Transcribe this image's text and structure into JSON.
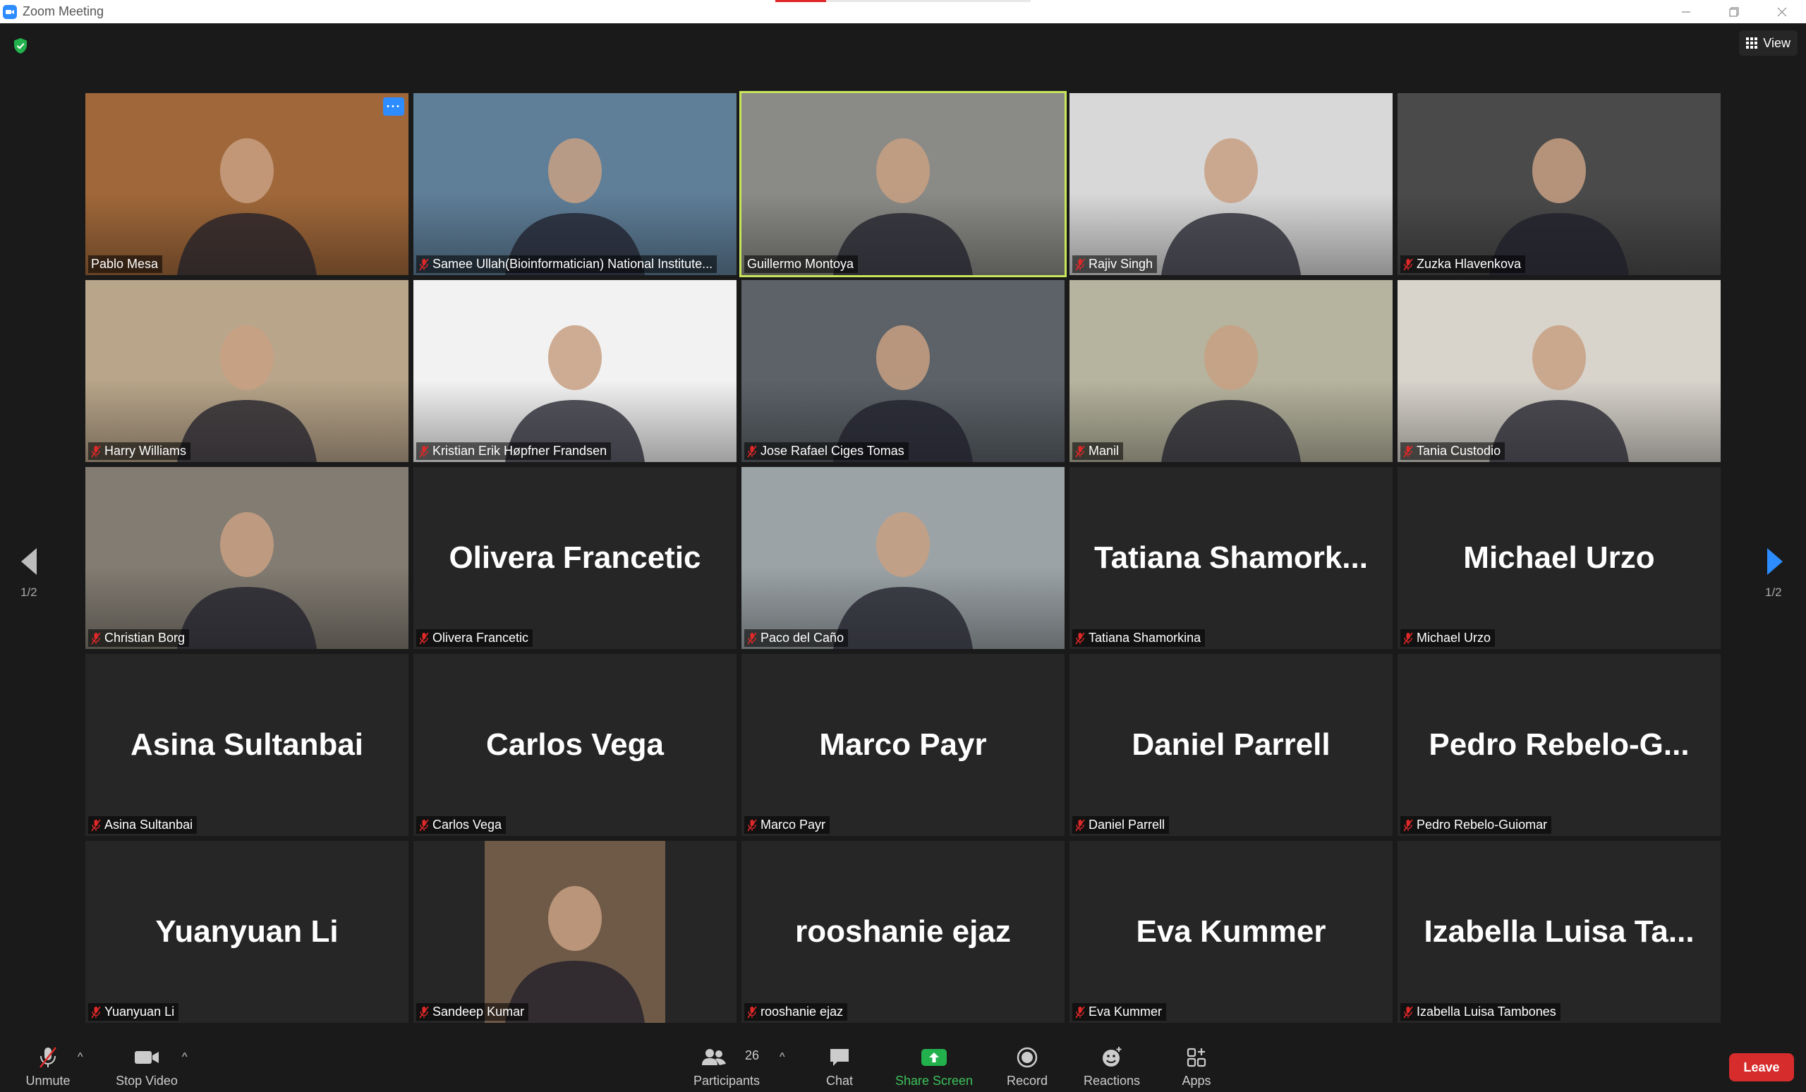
{
  "window": {
    "title": "Zoom Meeting"
  },
  "view": {
    "label": "View"
  },
  "pagination": {
    "left": "1/2",
    "right": "1/2"
  },
  "participants": [
    {
      "name": "Pablo Mesa",
      "video": true,
      "muted": false,
      "more": true,
      "bg": "#a0683a"
    },
    {
      "name": "Samee Ullah(Bioinformatician) National Institute...",
      "video": true,
      "muted": true,
      "bg": "#5f7e98"
    },
    {
      "name": "Guillermo Montoya",
      "video": true,
      "muted": false,
      "speaking": true,
      "bg": "#8a8a86"
    },
    {
      "name": "Rajiv Singh",
      "video": true,
      "muted": true,
      "bg": "#d8d8d8"
    },
    {
      "name": "Zuzka Hlavenkova",
      "video": true,
      "muted": true,
      "bg": "#4a4a4a"
    },
    {
      "name": "Harry Williams",
      "video": true,
      "muted": true,
      "bg": "#b8a58a"
    },
    {
      "name": "Kristian Erik Høpfner Frandsen",
      "video": true,
      "muted": true,
      "bg": "#f2f2f2"
    },
    {
      "name": "Jose Rafael Ciges Tomas",
      "video": true,
      "muted": true,
      "bg": "#5c6268"
    },
    {
      "name": "Manil",
      "video": true,
      "muted": true,
      "bg": "#b6b49e"
    },
    {
      "name": "Tania Custodio",
      "video": true,
      "muted": true,
      "bg": "#d8d4cc"
    },
    {
      "name": "Christian Borg",
      "video": true,
      "muted": true,
      "bg": "#827c72"
    },
    {
      "name": "Olivera Francetic",
      "display": "Olivera Francetic",
      "video": false,
      "muted": true
    },
    {
      "name": "Paco del Caño",
      "video": true,
      "muted": true,
      "bg": "#9ba3a6"
    },
    {
      "name": "Tatiana Shamorkina",
      "display": "Tatiana  Shamork...",
      "video": false,
      "muted": true
    },
    {
      "name": "Michael Urzo",
      "display": "Michael Urzo",
      "video": false,
      "muted": true
    },
    {
      "name": "Asina Sultanbai",
      "display": "Asina Sultanbai",
      "video": false,
      "muted": true
    },
    {
      "name": "Carlos Vega",
      "display": "Carlos Vega",
      "video": false,
      "muted": true
    },
    {
      "name": "Marco Payr",
      "display": "Marco Payr",
      "video": false,
      "muted": true
    },
    {
      "name": "Daniel Parrell",
      "display": "Daniel Parrell",
      "video": false,
      "muted": true
    },
    {
      "name": "Pedro Rebelo-Guiomar",
      "display": "Pedro  Rebelo-G...",
      "video": false,
      "muted": true
    },
    {
      "name": "Yuanyuan Li",
      "display": "Yuanyuan Li",
      "video": false,
      "muted": true
    },
    {
      "name": "Sandeep Kumar",
      "video": true,
      "muted": true,
      "bg": "#6f5a48",
      "pillarbox": true
    },
    {
      "name": "rooshanie ejaz",
      "display": "rooshanie ejaz",
      "video": false,
      "muted": true
    },
    {
      "name": "Eva Kummer",
      "display": "Eva Kummer",
      "video": false,
      "muted": true
    },
    {
      "name": "Izabella Luisa Tambones",
      "display": "Izabella  Luisa  Ta...",
      "video": false,
      "muted": true
    }
  ],
  "toolbar": {
    "unmute": "Unmute",
    "stop_video": "Stop Video",
    "participants": "Participants",
    "participant_count": "26",
    "chat": "Chat",
    "share_screen": "Share Screen",
    "record": "Record",
    "reactions": "Reactions",
    "apps": "Apps",
    "leave": "Leave"
  },
  "colors": {
    "accent": "#2d8cff",
    "speaking": "#c9e55a",
    "leave": "#d62c2c",
    "share": "#3dc05a",
    "muted": "#e02828"
  }
}
